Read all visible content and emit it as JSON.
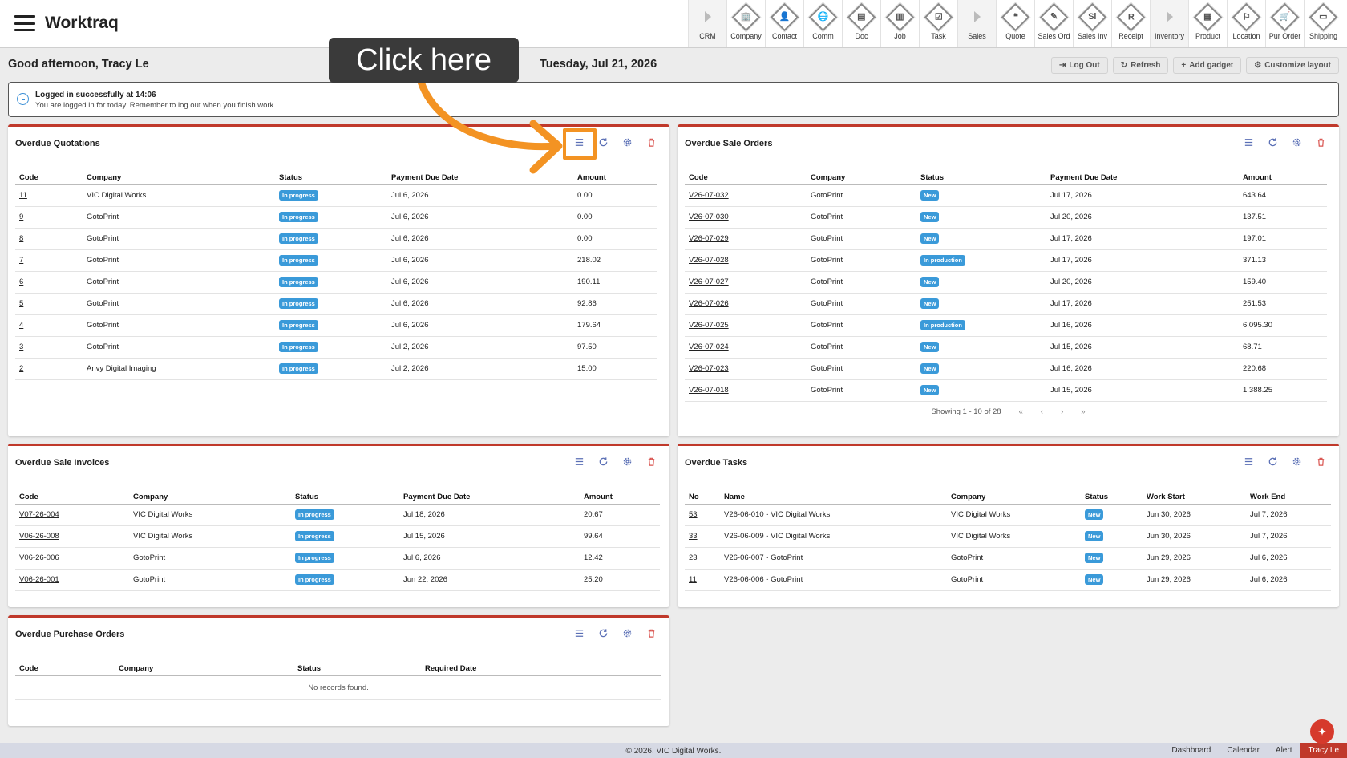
{
  "app": {
    "title": "Worktraq"
  },
  "modules": [
    {
      "label": "CRM",
      "icon": "crm-group-icon",
      "group": true
    },
    {
      "label": "Company",
      "icon": "company-icon",
      "glyph": "🏢"
    },
    {
      "label": "Contact",
      "icon": "contact-icon",
      "glyph": "👤"
    },
    {
      "label": "Comm",
      "icon": "comm-icon",
      "glyph": "🌐"
    },
    {
      "label": "Doc",
      "icon": "doc-icon",
      "glyph": "▤"
    },
    {
      "label": "Job",
      "icon": "job-icon",
      "glyph": "▥"
    },
    {
      "label": "Task",
      "icon": "task-icon",
      "glyph": "☑"
    },
    {
      "label": "Sales",
      "icon": "sales-group-icon",
      "group": true
    },
    {
      "label": "Quote",
      "icon": "quote-icon",
      "glyph": "❝"
    },
    {
      "label": "Sales Ord",
      "icon": "sales-order-icon",
      "glyph": "✎"
    },
    {
      "label": "Sales Inv",
      "icon": "sales-invoice-icon",
      "glyph": "Si"
    },
    {
      "label": "Receipt",
      "icon": "receipt-icon",
      "glyph": "R"
    },
    {
      "label": "Inventory",
      "icon": "inventory-group-icon",
      "group": true
    },
    {
      "label": "Product",
      "icon": "product-icon",
      "glyph": "▦"
    },
    {
      "label": "Location",
      "icon": "location-icon",
      "glyph": "⚐"
    },
    {
      "label": "Pur Order",
      "icon": "purchase-order-icon",
      "glyph": "🛒"
    },
    {
      "label": "Shipping",
      "icon": "shipping-icon",
      "glyph": "▭"
    }
  ],
  "header": {
    "greeting": "Good afternoon, Tracy Le",
    "date": "Tuesday, Jul 21, 2026",
    "actions": [
      {
        "label": "Log Out",
        "icon": "logout-icon",
        "glyph": "⇥"
      },
      {
        "label": "Refresh",
        "icon": "refresh-icon",
        "glyph": "↻"
      },
      {
        "label": "Add gadget",
        "icon": "plus-icon",
        "glyph": "+"
      },
      {
        "label": "Customize layout",
        "icon": "gear-icon",
        "glyph": "⚙"
      }
    ]
  },
  "annotation": {
    "callout": "Click here"
  },
  "notice": {
    "title": "Logged in successfully at 14:06",
    "message": "You are logged in for today. Remember to log out when you finish work."
  },
  "colors": {
    "in_progress": "#3a9ad9",
    "new": "#3a9ad9",
    "accent": "#c0392b",
    "highlight": "#f39323"
  },
  "panels": {
    "quotations": {
      "title": "Overdue Quotations",
      "columns": [
        "Code",
        "Company",
        "Status",
        "Payment Due Date",
        "Amount"
      ],
      "rows": [
        [
          "11",
          "VIC Digital Works",
          "In progress",
          "Jul 6, 2026",
          "0.00"
        ],
        [
          "9",
          "GotoPrint",
          "In progress",
          "Jul 6, 2026",
          "0.00"
        ],
        [
          "8",
          "GotoPrint",
          "In progress",
          "Jul 6, 2026",
          "0.00"
        ],
        [
          "7",
          "GotoPrint",
          "In progress",
          "Jul 6, 2026",
          "218.02"
        ],
        [
          "6",
          "GotoPrint",
          "In progress",
          "Jul 6, 2026",
          "190.11"
        ],
        [
          "5",
          "GotoPrint",
          "In progress",
          "Jul 6, 2026",
          "92.86"
        ],
        [
          "4",
          "GotoPrint",
          "In progress",
          "Jul 6, 2026",
          "179.64"
        ],
        [
          "3",
          "GotoPrint",
          "In progress",
          "Jul 2, 2026",
          "97.50"
        ],
        [
          "2",
          "Anvy Digital Imaging",
          "In progress",
          "Jul 2, 2026",
          "15.00"
        ]
      ]
    },
    "sale_orders": {
      "title": "Overdue Sale Orders",
      "columns": [
        "Code",
        "Company",
        "Status",
        "Payment Due Date",
        "Amount"
      ],
      "rows": [
        [
          "V26-07-032",
          "GotoPrint",
          "New",
          "Jul 17, 2026",
          "643.64"
        ],
        [
          "V26-07-030",
          "GotoPrint",
          "New",
          "Jul 20, 2026",
          "137.51"
        ],
        [
          "V26-07-029",
          "GotoPrint",
          "New",
          "Jul 17, 2026",
          "197.01"
        ],
        [
          "V26-07-028",
          "GotoPrint",
          "In production",
          "Jul 17, 2026",
          "371.13"
        ],
        [
          "V26-07-027",
          "GotoPrint",
          "New",
          "Jul 20, 2026",
          "159.40"
        ],
        [
          "V26-07-026",
          "GotoPrint",
          "New",
          "Jul 17, 2026",
          "251.53"
        ],
        [
          "V26-07-025",
          "GotoPrint",
          "In production",
          "Jul 16, 2026",
          "6,095.30"
        ],
        [
          "V26-07-024",
          "GotoPrint",
          "New",
          "Jul 15, 2026",
          "68.71"
        ],
        [
          "V26-07-023",
          "GotoPrint",
          "New",
          "Jul 16, 2026",
          "220.68"
        ],
        [
          "V26-07-018",
          "GotoPrint",
          "New",
          "Jul 15, 2026",
          "1,388.25"
        ]
      ],
      "pager": {
        "text": "Showing 1 - 10 of 28",
        "first": "«",
        "prev": "‹",
        "next": "›",
        "last": "»"
      }
    },
    "sale_invoices": {
      "title": "Overdue Sale Invoices",
      "columns": [
        "Code",
        "Company",
        "Status",
        "Payment Due Date",
        "Amount"
      ],
      "rows": [
        [
          "V07-26-004",
          "VIC Digital Works",
          "In progress",
          "Jul 18, 2026",
          "20.67"
        ],
        [
          "V06-26-008",
          "VIC Digital Works",
          "In progress",
          "Jul 15, 2026",
          "99.64"
        ],
        [
          "V06-26-006",
          "GotoPrint",
          "In progress",
          "Jul 6, 2026",
          "12.42"
        ],
        [
          "V06-26-001",
          "GotoPrint",
          "In progress",
          "Jun 22, 2026",
          "25.20"
        ]
      ]
    },
    "tasks": {
      "title": "Overdue Tasks",
      "columns": [
        "No",
        "Name",
        "Company",
        "Status",
        "Work Start",
        "Work End"
      ],
      "rows": [
        [
          "53",
          "V26-06-010 - VIC Digital Works",
          "VIC Digital Works",
          "New",
          "Jun 30, 2026",
          "Jul 7, 2026"
        ],
        [
          "33",
          "V26-06-009 - VIC Digital Works",
          "VIC Digital Works",
          "New",
          "Jun 30, 2026",
          "Jul 7, 2026"
        ],
        [
          "23",
          "V26-06-007 - GotoPrint",
          "GotoPrint",
          "New",
          "Jun 29, 2026",
          "Jul 6, 2026"
        ],
        [
          "11",
          "V26-06-006 - GotoPrint",
          "GotoPrint",
          "New",
          "Jun 29, 2026",
          "Jul 6, 2026"
        ]
      ]
    },
    "purchase_orders": {
      "title": "Overdue Purchase Orders",
      "columns": [
        "Code",
        "Company",
        "Status",
        "Required Date"
      ],
      "rows": [],
      "empty_text": "No records found."
    }
  },
  "footer": {
    "copyright": "© 2026, VIC Digital Works.",
    "nav": [
      "Dashboard",
      "Calendar",
      "Alert"
    ],
    "user": "Tracy Le"
  }
}
